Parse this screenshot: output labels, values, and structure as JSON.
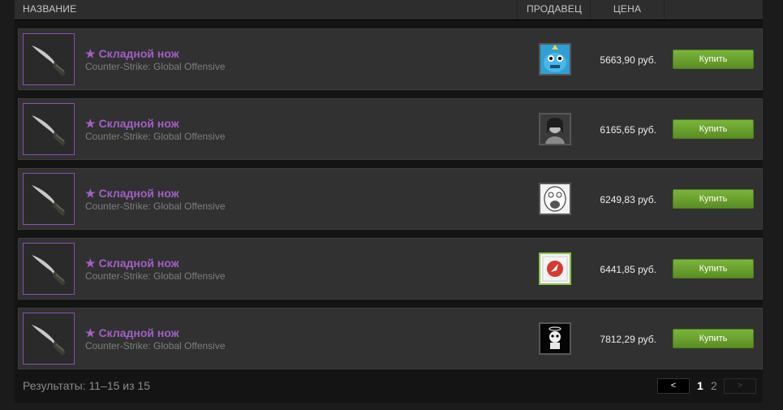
{
  "header": {
    "name": "НАЗВАНИЕ",
    "seller": "ПРОДАВЕЦ",
    "price": "ЦЕНА"
  },
  "colors": {
    "item_name": "#a35fc7",
    "buy_button": "#6ea32f",
    "panel": "#313131"
  },
  "listings": [
    {
      "name": "Складной нож",
      "game": "Counter-Strike: Global Offensive",
      "price": "5663,90 руб.",
      "buy": "Купить",
      "avatar": "blue-creature-avatar"
    },
    {
      "name": "Складной нож",
      "game": "Counter-Strike: Global Offensive",
      "price": "6165,65 руб.",
      "buy": "Купить",
      "avatar": "grayscale-photo-avatar"
    },
    {
      "name": "Складной нож",
      "game": "Counter-Strike: Global Offensive",
      "price": "6249,83 руб.",
      "buy": "Купить",
      "avatar": "meme-face-avatar"
    },
    {
      "name": "Складной нож",
      "game": "Counter-Strike: Global Offensive",
      "price": "6441,85 руб.",
      "buy": "Купить",
      "avatar": "red-logo-avatar"
    },
    {
      "name": "Складной нож",
      "game": "Counter-Strike: Global Offensive",
      "price": "7812,29 руб.",
      "buy": "Купить",
      "avatar": "skull-angel-avatar"
    }
  ],
  "footer": {
    "results": "Результаты: 11–15 из 15",
    "prev": "<",
    "next": ">",
    "pages": [
      "1",
      "2"
    ],
    "current_page": "1"
  }
}
